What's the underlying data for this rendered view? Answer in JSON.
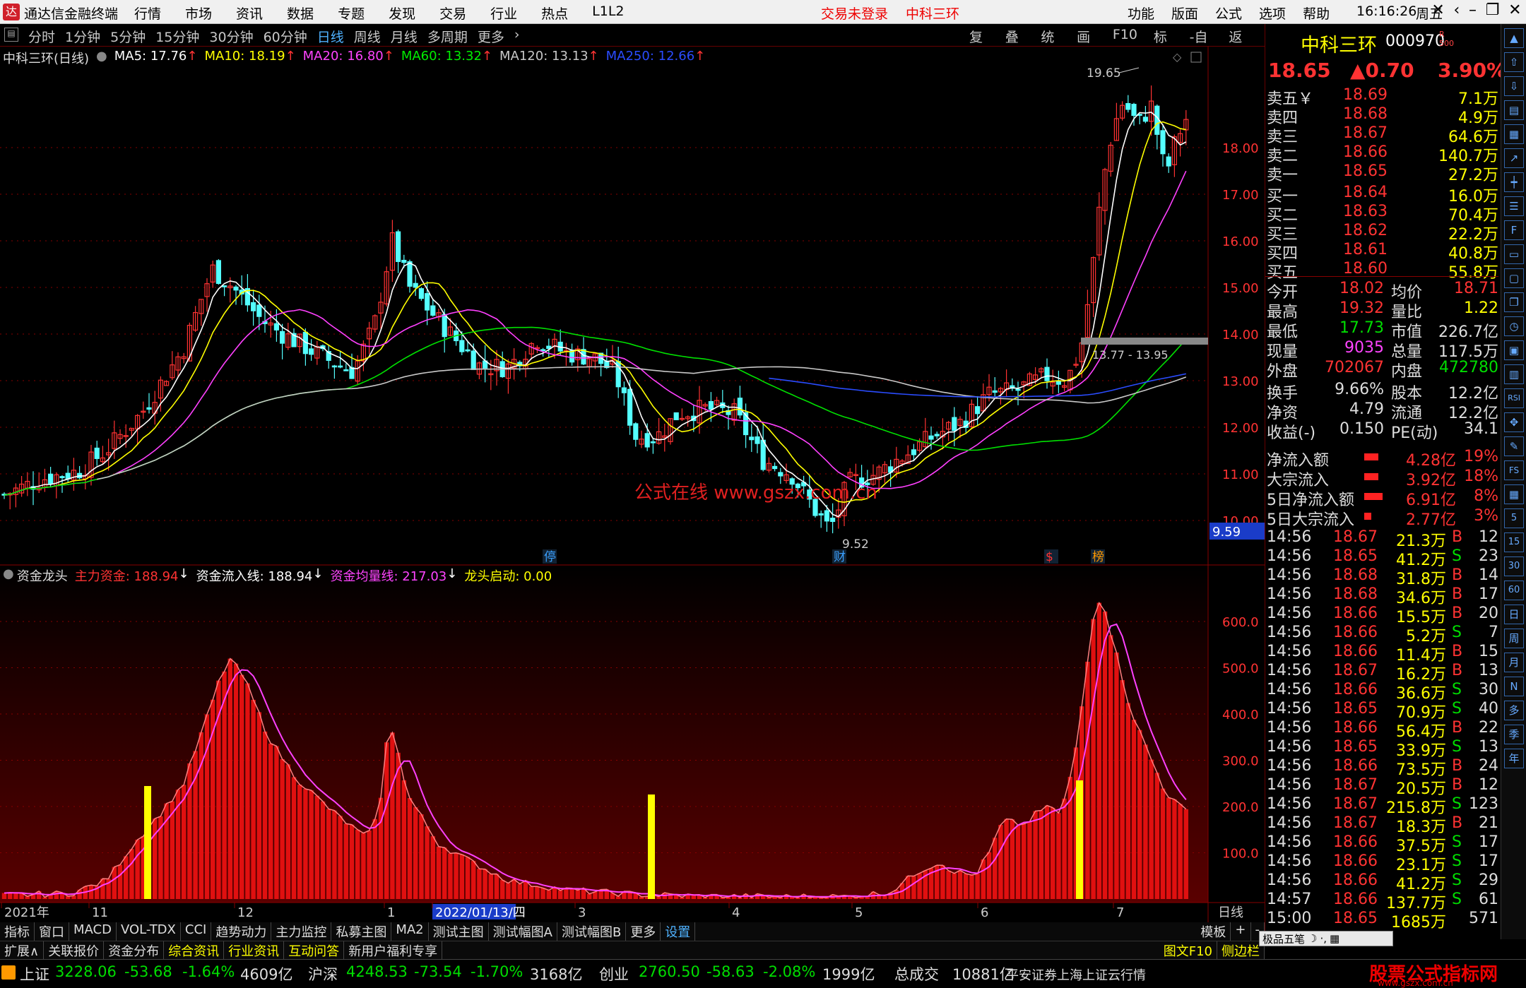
{
  "title": {
    "app": "通达信金融终端",
    "menu": [
      "行情",
      "市场",
      "资讯",
      "数据",
      "专题",
      "发现",
      "交易",
      "行业",
      "热点",
      "L1L2"
    ],
    "trade_status": "交易未登录",
    "stock_center": "中科三环",
    "right_menu": [
      "功能",
      "版面",
      "公式",
      "选项",
      "帮助"
    ],
    "time": "16:16:26",
    "weekday": "周五"
  },
  "toolbar": {
    "periods": [
      "分时",
      "1分钟",
      "5分钟",
      "15分钟",
      "30分钟",
      "60分钟",
      "日线",
      "周线",
      "月线",
      "多周期",
      "更多"
    ],
    "tools": [
      "复权",
      "叠加",
      "统计",
      "画线",
      "F10",
      "标记",
      "-自选",
      "返回"
    ]
  },
  "upper": {
    "stock": "中科三环(日线)",
    "ma": [
      {
        "label": "MA5: 17.76",
        "color": "#ffffff"
      },
      {
        "label": "MA10: 18.19",
        "color": "#ffff00"
      },
      {
        "label": "MA20: 16.80",
        "color": "#ff40ff"
      },
      {
        "label": "MA60: 13.32",
        "color": "#00e000"
      },
      {
        "label": "MA120: 13.13",
        "color": "#c8c8c8"
      },
      {
        "label": "MA250: 12.66",
        "color": "#2a4cff"
      }
    ],
    "high_label": "19.65",
    "low_label": "9.52",
    "range_label": "13.77 - 13.95",
    "price_tag": "9.59",
    "watermark": "公式在线  www.gszx.com.cn",
    "markers": [
      "停",
      "财",
      "$",
      "榜"
    ],
    "yaxis": [
      "18.00",
      "17.00",
      "16.00",
      "15.00",
      "14.00",
      "13.00",
      "12.00",
      "11.00",
      "10.00"
    ]
  },
  "lower": {
    "name": "资金龙头",
    "lines": [
      {
        "label": "主力资金: 188.94",
        "color": "#ff3030"
      },
      {
        "label": "资金流入线: 188.94",
        "color": "#ffffff"
      },
      {
        "label": "资金均量线: 217.03",
        "color": "#ff40ff"
      },
      {
        "label": "龙头启动: 0.00",
        "color": "#ffff00"
      }
    ],
    "yaxis": [
      "600.0",
      "500.0",
      "400.0",
      "300.0",
      "200.0",
      "100.0"
    ]
  },
  "xaxis": {
    "labels": [
      "2021年",
      "11",
      "12",
      "1",
      "2022/01/13/四",
      "3",
      "4",
      "5",
      "6",
      "7"
    ],
    "period": "日线"
  },
  "quote": {
    "name": "中科三环",
    "code": "000970",
    "price": "18.65",
    "change": "▲0.70",
    "pct": "3.90%",
    "asks": [
      [
        "卖五￥",
        "18.69",
        "7.1万"
      ],
      [
        "卖四",
        "18.68",
        "4.9万"
      ],
      [
        "卖三",
        "18.67",
        "64.6万"
      ],
      [
        "卖二",
        "18.66",
        "140.7万"
      ],
      [
        "卖一",
        "18.65",
        "27.2万"
      ]
    ],
    "bids": [
      [
        "买一",
        "18.64",
        "16.0万"
      ],
      [
        "买二",
        "18.63",
        "70.4万"
      ],
      [
        "买三",
        "18.62",
        "22.2万"
      ],
      [
        "买四",
        "18.61",
        "40.8万"
      ],
      [
        "买五",
        "18.60",
        "55.8万"
      ]
    ],
    "stats": [
      [
        "今开",
        "18.02",
        "均价",
        "18.71"
      ],
      [
        "最高",
        "19.32",
        "量比",
        "1.22"
      ],
      [
        "最低",
        "17.73",
        "市值",
        "226.7亿"
      ],
      [
        "现量",
        "9035",
        "总量",
        "117.5万"
      ],
      [
        "外盘",
        "702067",
        "内盘",
        "472780"
      ],
      [
        "换手",
        "9.66%",
        "股本",
        "12.2亿"
      ],
      [
        "净资",
        "4.79",
        "流通",
        "12.2亿"
      ],
      [
        "收益(-)",
        "0.150",
        "PE(动)",
        "34.1"
      ]
    ],
    "flows": [
      [
        "净流入额",
        "4.28亿",
        "19%"
      ],
      [
        "大宗流入",
        "3.92亿",
        "18%"
      ],
      [
        "5日净流入额",
        "6.91亿",
        "8%"
      ],
      [
        "5日大宗流入",
        "2.77亿",
        "3%"
      ]
    ],
    "ticks": [
      [
        "14:56",
        "18.67",
        "21.3万",
        "B",
        "12"
      ],
      [
        "14:56",
        "18.65",
        "41.2万",
        "S",
        "23"
      ],
      [
        "14:56",
        "18.68",
        "31.8万",
        "B",
        "14"
      ],
      [
        "14:56",
        "18.68",
        "34.6万",
        "B",
        "17"
      ],
      [
        "14:56",
        "18.66",
        "15.5万",
        "B",
        "20"
      ],
      [
        "14:56",
        "18.66",
        "5.2万",
        "S",
        "7"
      ],
      [
        "14:56",
        "18.66",
        "11.4万",
        "B",
        "15"
      ],
      [
        "14:56",
        "18.67",
        "16.2万",
        "B",
        "13"
      ],
      [
        "14:56",
        "18.66",
        "36.6万",
        "S",
        "30"
      ],
      [
        "14:56",
        "18.65",
        "70.9万",
        "S",
        "40"
      ],
      [
        "14:56",
        "18.66",
        "56.4万",
        "B",
        "22"
      ],
      [
        "14:56",
        "18.65",
        "33.9万",
        "S",
        "13"
      ],
      [
        "14:56",
        "18.66",
        "73.5万",
        "B",
        "24"
      ],
      [
        "14:56",
        "18.67",
        "20.5万",
        "B",
        "12"
      ],
      [
        "14:56",
        "18.67",
        "215.8万",
        "S",
        "123"
      ],
      [
        "14:56",
        "18.67",
        "18.3万",
        "B",
        "21"
      ],
      [
        "14:56",
        "18.66",
        "37.5万",
        "S",
        "17"
      ],
      [
        "14:56",
        "18.66",
        "23.1万",
        "S",
        "17"
      ],
      [
        "14:56",
        "18.66",
        "41.2万",
        "S",
        "29"
      ],
      [
        "14:57",
        "18.66",
        "137.7万",
        "S",
        "61"
      ],
      [
        "15:00",
        "18.65",
        "1685万",
        "",
        "571"
      ]
    ]
  },
  "sidebar": [
    "日",
    "周",
    "月",
    "N",
    "多",
    "季",
    "年"
  ],
  "tabs1": [
    "指标",
    "窗口",
    "MACD",
    "VOL-TDX",
    "CCI",
    "趋势动力",
    "主力监控",
    "私募主图",
    "MA2",
    "测试主图",
    "测试幅图A",
    "测试幅图B",
    "更多",
    "设置"
  ],
  "tabs1_right": [
    "模板",
    "+",
    "-"
  ],
  "tabs2": [
    "扩展∧",
    "关联报价",
    "资金分布",
    "综合资讯",
    "行业资讯",
    "互动问答",
    "新用户福利专享"
  ],
  "tabs2_right": [
    "图文F10",
    "侧边栏"
  ],
  "status": [
    {
      "name": "上证",
      "val": "3228.06",
      "chg": "-53.68",
      "pct": "-1.64%",
      "amt": "4609亿"
    },
    {
      "name": "沪深",
      "val": "4248.53",
      "chg": "-73.54",
      "pct": "-1.70%",
      "amt": "3168亿"
    },
    {
      "name": "创业",
      "val": "2760.50",
      "chg": "-58.63",
      "pct": "-2.08%",
      "amt": "1999亿"
    }
  ],
  "status_total": "总成交",
  "status_total_val": "10881亿",
  "status_broker": "平安证券上海上证云行情",
  "corner_brand": "股票公式指标网",
  "corner_url": "www.gszx.com.cn",
  "tooltip_label": "极品五笔"
}
